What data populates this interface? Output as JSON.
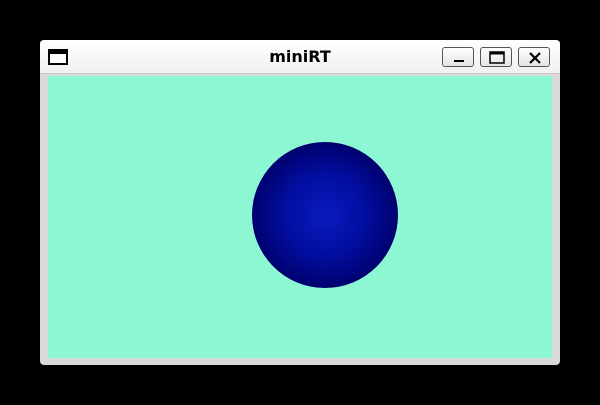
{
  "window": {
    "title": "miniRT",
    "controls": {
      "menu_icon": "window-menu-icon",
      "minimize_icon": "minimize-icon",
      "maximize_icon": "maximize-icon",
      "close_icon": "close-icon"
    }
  },
  "scene": {
    "background_color": "#8df6d2",
    "sphere_color": "#00008b",
    "sphere_highlight": "#0a1bbf"
  }
}
